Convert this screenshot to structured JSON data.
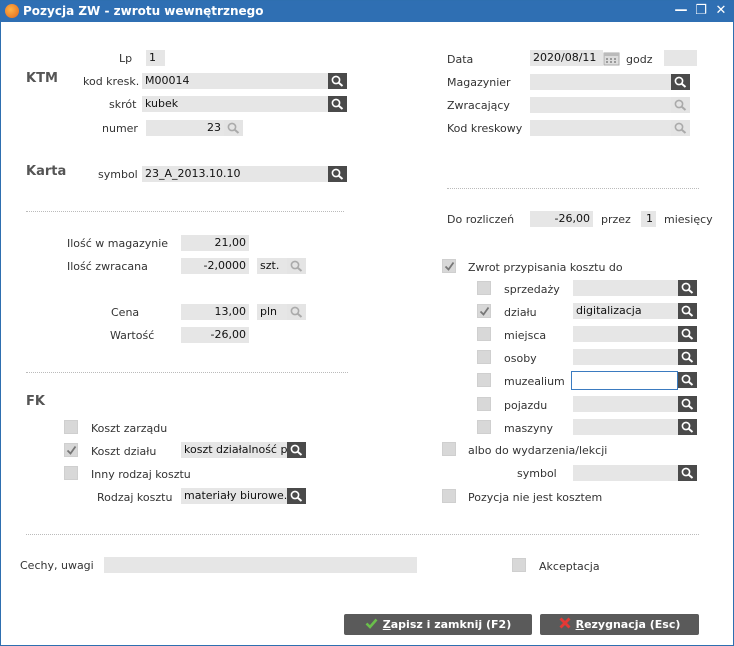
{
  "window": {
    "title": "Pozycja ZW - zwrotu wewnętrznego",
    "minimize": "—",
    "maximize": "❐",
    "close": "✕"
  },
  "ktm": {
    "section": "KTM",
    "lp_label": "Lp",
    "lp_value": "1",
    "barcode_label": "kod kresk.",
    "barcode_value": "M00014",
    "short_label": "skrót",
    "short_value": "kubek",
    "number_label": "numer",
    "number_value": "23"
  },
  "karta": {
    "section": "Karta",
    "symbol_label": "symbol",
    "symbol_value": "23_A_2013.10.10"
  },
  "header_right": {
    "date_label": "Data",
    "date_value": "2020/08/11",
    "hour_label": "godz",
    "hour_value": "",
    "storekeeper_label": "Magazynier",
    "storekeeper_value": "",
    "returner_label": "Zwracający",
    "returner_value": "",
    "barcode_label": "Kod kreskowy",
    "barcode_value": ""
  },
  "settlement": {
    "label": "Do rozliczeń",
    "value": "-26,00",
    "over_label": "przez",
    "months_value": "1",
    "months_label": "miesięcy"
  },
  "quantities": {
    "stock_label": "Ilość w magazynie",
    "stock_value": "21,00",
    "return_label": "Ilość zwracana",
    "return_value": "-2,0000",
    "unit": "szt.",
    "price_label": "Cena",
    "price_value": "13,00",
    "currency": "pln",
    "value_label": "Wartość",
    "value_value": "-26,00"
  },
  "cost_assign": {
    "label": "Zwrot przypisania kosztu do",
    "checked": true,
    "items": [
      {
        "label": "sprzedaży",
        "checked": false,
        "value": ""
      },
      {
        "label": "działu",
        "checked": true,
        "value": "digitalizacja"
      },
      {
        "label": "miejsca",
        "checked": false,
        "value": ""
      },
      {
        "label": "osoby",
        "checked": false,
        "value": ""
      },
      {
        "label": "muzealium",
        "checked": false,
        "value": ""
      },
      {
        "label": "pojazdu",
        "checked": false,
        "value": ""
      },
      {
        "label": "maszyny",
        "checked": false,
        "value": ""
      }
    ],
    "event_label": "albo do wydarzenia/lekcji",
    "symbol_label": "symbol",
    "symbol_value": "",
    "not_cost_label": "Pozycja nie jest kosztem"
  },
  "fk": {
    "section": "FK",
    "mgmt_label": "Koszt zarządu",
    "dept_label": "Koszt działu",
    "dept_value": "koszt działalność pod",
    "other_label": "Inny rodzaj kosztu",
    "type_label": "Rodzaj kosztu",
    "type_value": "materiały  biurowe."
  },
  "footer": {
    "notes_label": "Cechy, uwagi",
    "notes_value": "",
    "accept_label": "Akceptacja",
    "save_label_u": "Z",
    "save_label_rest": "apisz i zamknij (F2)",
    "cancel_label_u": "R",
    "cancel_label_rest": "ezygnacja (Esc)"
  },
  "colors": {
    "title_bar": "#2f6fb3",
    "field": "#e6e6e6",
    "button": "#5a5a5a",
    "accent_ok": "#4caf50",
    "accent_cancel": "#e53935"
  }
}
